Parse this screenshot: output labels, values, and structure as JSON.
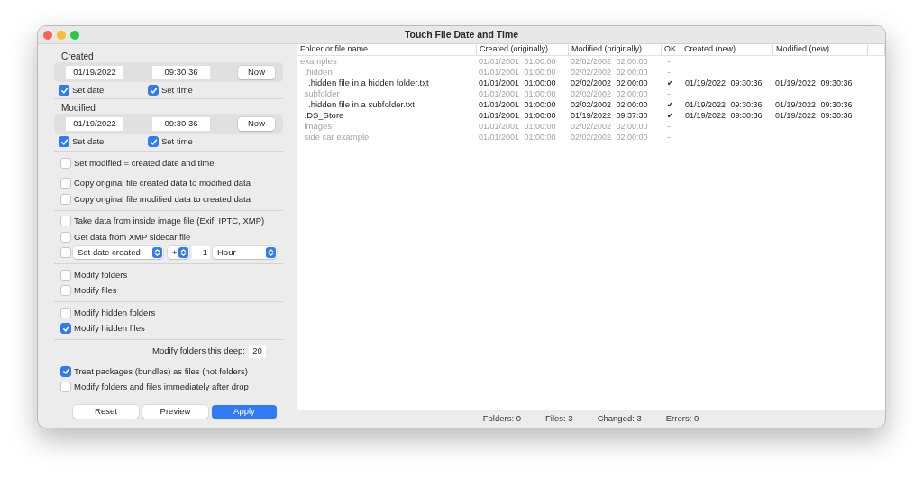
{
  "window": {
    "title": "Touch File Date and Time"
  },
  "created": {
    "label": "Created",
    "date": "01/19/2022",
    "time": "09:30:36",
    "now_button": "Now",
    "set_date": {
      "label": "Set date",
      "checked": true
    },
    "set_time": {
      "label": "Set time",
      "checked": true
    }
  },
  "modified": {
    "label": "Modified",
    "date": "01/19/2022",
    "time": "09:30:36",
    "now_button": "Now",
    "set_date": {
      "label": "Set date",
      "checked": true
    },
    "set_time": {
      "label": "Set time",
      "checked": true
    }
  },
  "option_groups": [
    {
      "rule_below": false,
      "items": [
        {
          "kind": "checkbox",
          "label": "Set modified = created date and time",
          "checked": false
        }
      ]
    },
    {
      "rule_below": true,
      "items": [
        {
          "kind": "checkbox",
          "label": "Copy original file created data to modified data",
          "checked": false
        },
        {
          "kind": "checkbox",
          "label": "Copy original file modified data to created data",
          "checked": false
        }
      ]
    },
    {
      "rule_below": true,
      "items": [
        {
          "kind": "checkbox",
          "label": "Take data from inside image file (Exif, IPTC, XMP)",
          "checked": false
        },
        {
          "kind": "checkbox",
          "label": "Get data from XMP sidecar file",
          "checked": false
        },
        {
          "kind": "offset",
          "checked": false,
          "field": "Set date created",
          "sign": "+",
          "amount": "1",
          "unit": "Hour"
        }
      ]
    },
    {
      "rule_below": true,
      "items": [
        {
          "kind": "checkbox",
          "label": "Modify folders",
          "checked": false
        },
        {
          "kind": "checkbox",
          "label": "Modify files",
          "checked": false
        }
      ]
    },
    {
      "rule_below": true,
      "items": [
        {
          "kind": "checkbox",
          "label": "Modify hidden folders",
          "checked": false
        },
        {
          "kind": "checkbox",
          "label": "Modify hidden files",
          "checked": true
        }
      ]
    },
    {
      "rule_below": false,
      "items": [
        {
          "kind": "number",
          "label": "Modify folders this deep:",
          "value": "20"
        },
        {
          "kind": "checkbox",
          "label": "Treat packages (bundles) as files (not folders)",
          "checked": true
        },
        {
          "kind": "checkbox",
          "label": "Modify folders and files immediately after drop",
          "checked": false
        }
      ]
    }
  ],
  "buttons": [
    {
      "label": "Reset",
      "kind": "default"
    },
    {
      "label": "Preview",
      "kind": "default"
    },
    {
      "label": "Apply",
      "kind": "primary"
    }
  ],
  "table": {
    "columns": [
      "Folder or file name",
      "Created (originally)",
      "Modified (originally)",
      "OK",
      "Created (new)",
      "Modified (new)"
    ],
    "rows": [
      {
        "name": "examples",
        "changed": false,
        "created_originally": "01/01/2001 01:00:00",
        "modified_originally": "02/02/2002 02:00:00",
        "ok": "–",
        "children": [
          {
            "name": ".hidden",
            "changed": false,
            "created_originally": "01/01/2001 01:00:00",
            "modified_originally": "02/02/2002 02:00:00",
            "ok": "–",
            "children": [
              {
                "name": ".hidden file in a hidden folder.txt",
                "changed": true,
                "created_originally": "01/01/2001 01:00:00",
                "modified_originally": "02/02/2002 02:00:00",
                "ok": "✔",
                "created_new": "01/19/2022 09:30:36",
                "modified_new": "01/19/2022 09:30:36"
              }
            ]
          },
          {
            "name": "subfolder",
            "changed": false,
            "created_originally": "01/01/2001 01:00:00",
            "modified_originally": "02/02/2002 02:00:00",
            "ok": "–",
            "children": [
              {
                "name": ".hidden file in a subfolder.txt",
                "changed": true,
                "created_originally": "01/01/2001 01:00:00",
                "modified_originally": "02/02/2002 02:00:00",
                "ok": "✔",
                "created_new": "01/19/2022 09:30:36",
                "modified_new": "01/19/2022 09:30:36"
              }
            ]
          },
          {
            "name": ".DS_Store",
            "changed": true,
            "created_originally": "01/01/2001 01:00:00",
            "modified_originally": "01/19/2022 09:37:30",
            "ok": "✔",
            "created_new": "01/19/2022 09:30:36",
            "modified_new": "01/19/2022 09:30:36"
          },
          {
            "name": "images",
            "changed": false,
            "created_originally": "01/01/2001 01:00:00",
            "modified_originally": "02/02/2002 02:00:00",
            "ok": "–"
          },
          {
            "name": "side car example",
            "changed": false,
            "created_originally": "01/01/2001 01:00:00",
            "modified_originally": "02/02/2002 02:00:00",
            "ok": "–"
          }
        ]
      }
    ]
  },
  "status_bar": [
    "Folders: 0",
    "Files: 3",
    "Changed: 3",
    "Errors: 0"
  ]
}
